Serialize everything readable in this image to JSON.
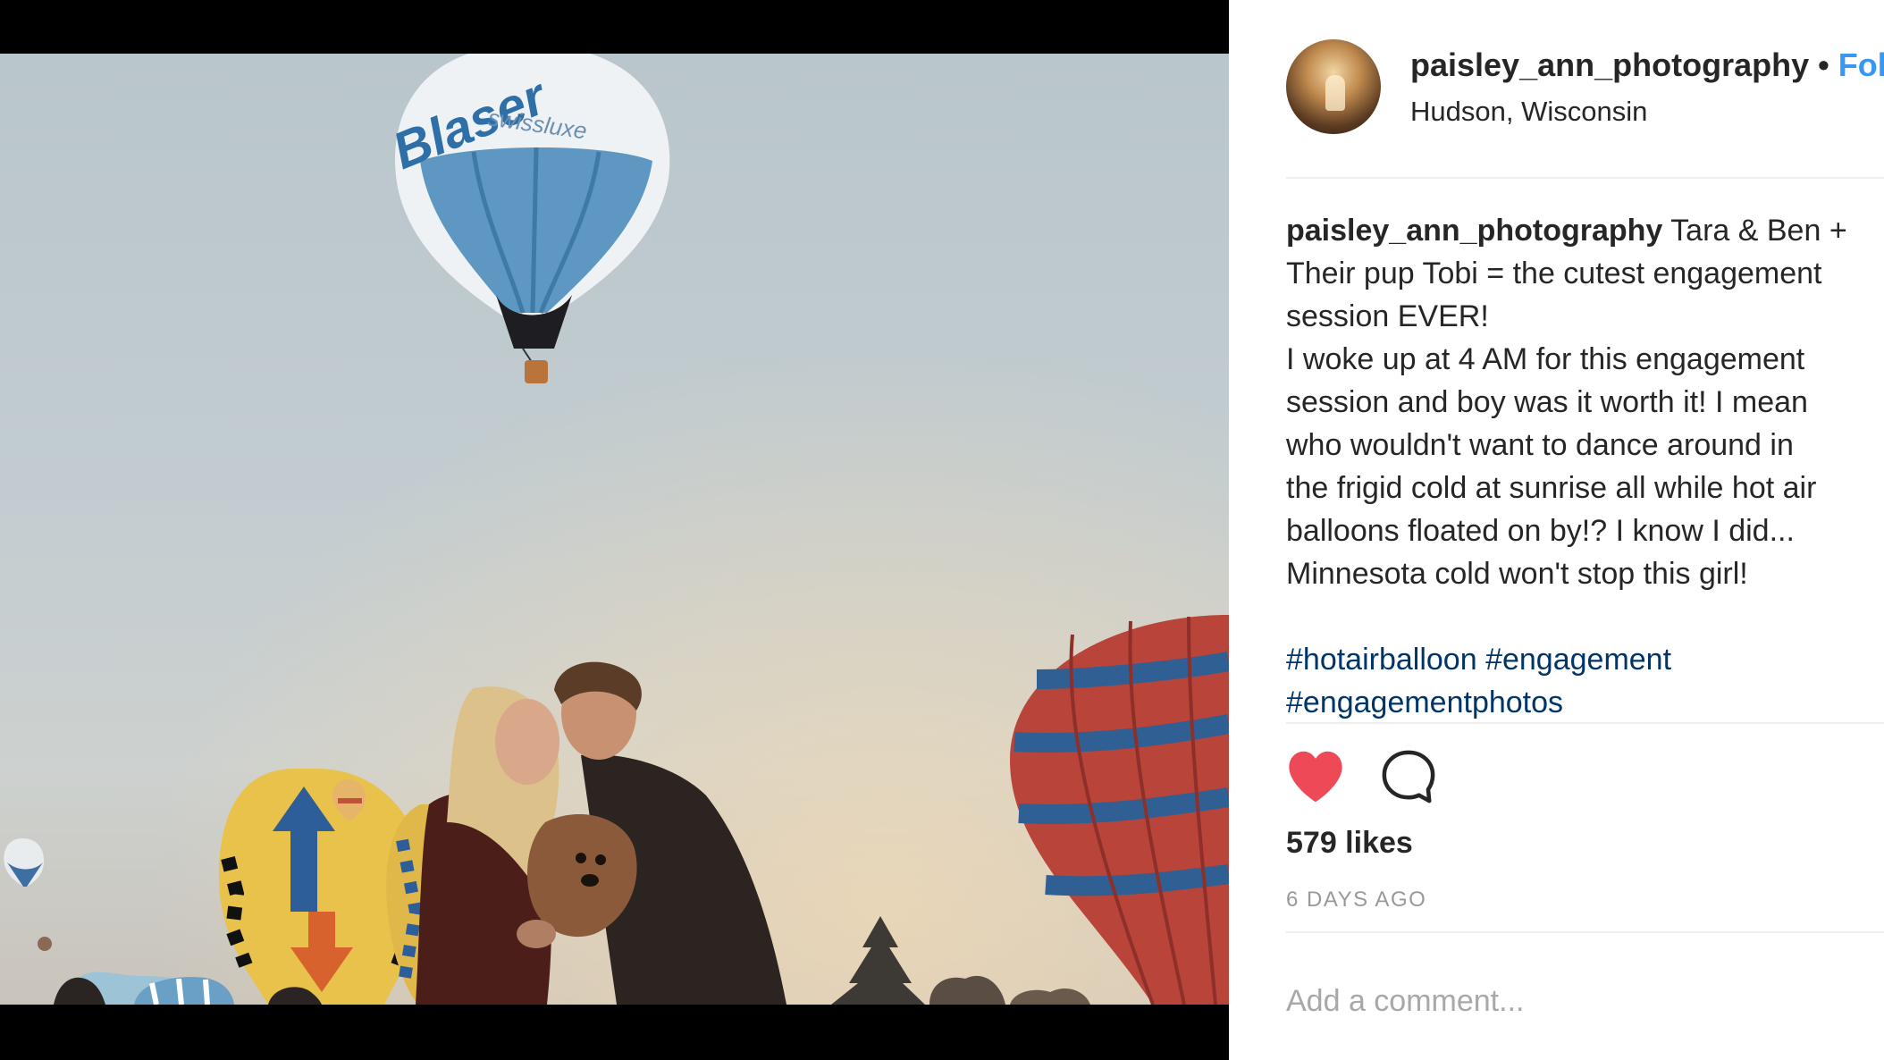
{
  "post": {
    "username": "paisley_ann_photography",
    "separator": "•",
    "follow_label": "Fol",
    "location": "Hudson, Wisconsin"
  },
  "caption": {
    "username": "paisley_ann_photography",
    "lines": [
      " Tara & Ben +",
      "Their pup Tobi = the cutest engagement",
      "session EVER!",
      "I woke up at 4 AM for this engagement",
      "session and boy was it worth it! I mean",
      "who wouldn't want to dance around in",
      "the frigid cold at sunrise all while hot air",
      "balloons floated on by!? I know I did...",
      "Minnesota cold won't stop this girl!"
    ]
  },
  "hashtags": [
    "#hotairballoon",
    "#engagement",
    "#engagementphotos"
  ],
  "actions": {
    "like_icon": "heart-filled-icon",
    "comment_icon": "comment-bubble-icon",
    "like_color": "#ed4956"
  },
  "likes": "579 likes",
  "timestamp": "6 DAYS AGO",
  "comment": {
    "placeholder": "Add a comment..."
  },
  "photo": {
    "balloon_text": "Blaser",
    "balloon_subtext": "swissluxe"
  },
  "colors": {
    "link": "#3897f0",
    "hashtag": "#003569",
    "muted": "#999999"
  }
}
